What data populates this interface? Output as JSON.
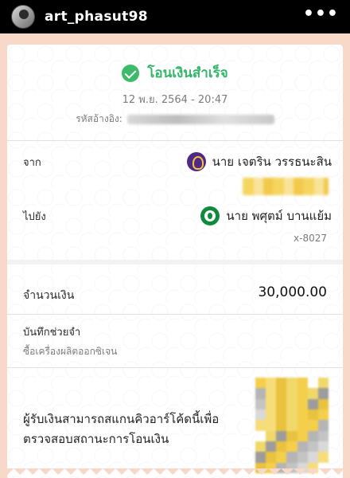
{
  "header": {
    "username": "art_phasut98",
    "more_label": "•••",
    "icons": {
      "avatar": "profile-avatar",
      "more": "more-options-icon"
    }
  },
  "receipt": {
    "status": "โอนเงินสำเร็จ",
    "datetime": "12 พ.ย. 2564 - 20:47",
    "ref_label": "รหัสอ้างอิง:",
    "from_label": "จาก",
    "from_name": "นาย เจตริน วรรธนะสิน",
    "to_label": "ไปยัง",
    "to_name": "นาย พศุตม์ บานแย้ม",
    "to_account": "x-8027",
    "amount_label": "จำนวนเงิน",
    "amount": "30,000.00",
    "memo_label": "บันทึกช่วยจำ",
    "memo_text": "ซื้อเครื่องผลิตออกซิเจน",
    "qr_line1": "ผู้รับเงินสามารถสแกนคิวอาร์โค้ดนี้เพื่อ",
    "qr_line2": "ตรวจสอบสถานะการโอนเงิน"
  },
  "colors": {
    "success_green": "#35b56a",
    "frame_peach": "#f7d8c9",
    "bank_from": "#4e2a84",
    "bank_to": "#108a3c"
  }
}
